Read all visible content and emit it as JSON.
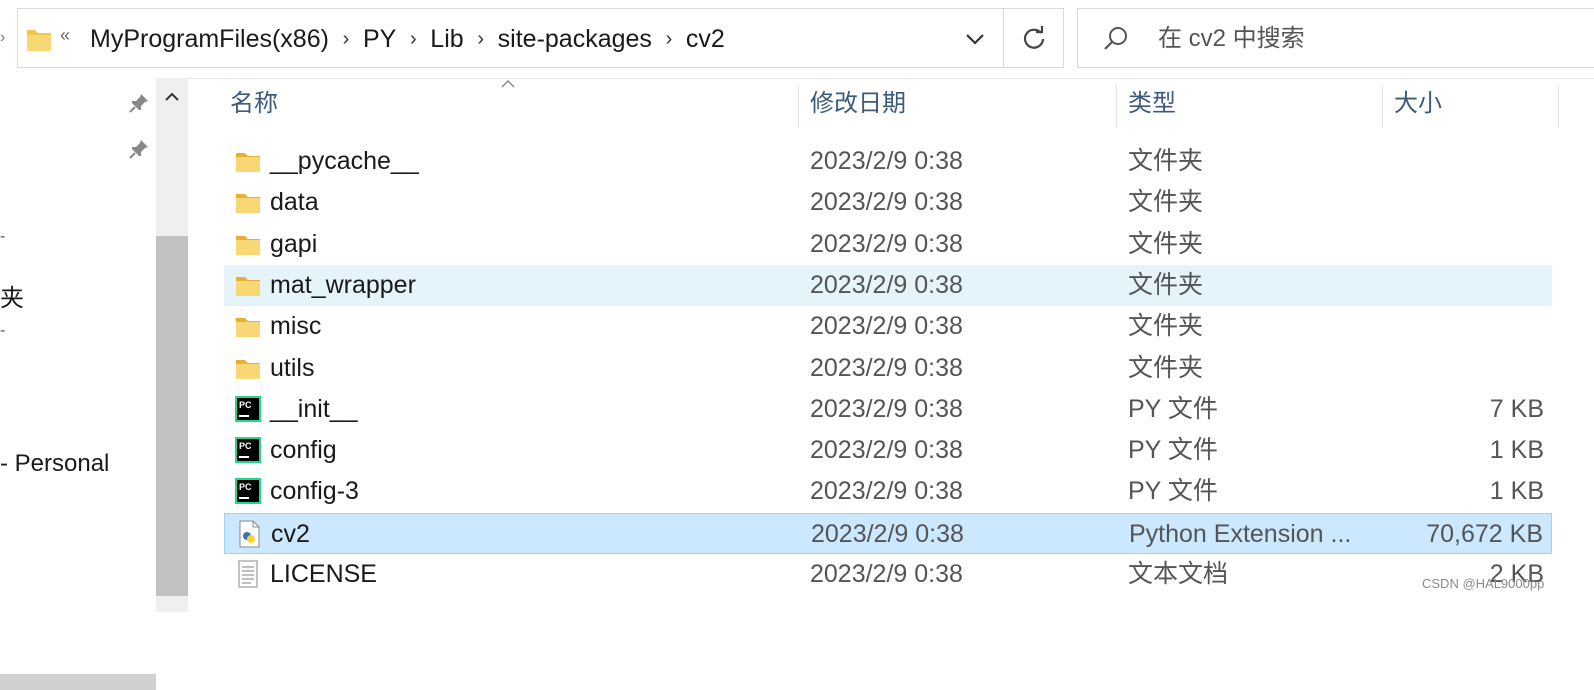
{
  "address_bar": {
    "overflow": "«",
    "crumbs": [
      "MyProgramFiles(x86)",
      "PY",
      "Lib",
      "site-packages",
      "cv2"
    ]
  },
  "search": {
    "placeholder": "在 cv2 中搜索"
  },
  "nav": {
    "frag_1": "夹",
    "frag_2": " - Personal"
  },
  "columns": {
    "name": "名称",
    "date": "修改日期",
    "type": "类型",
    "size": "大小"
  },
  "files": [
    {
      "name": "__pycache__",
      "date": "2023/2/9 0:38",
      "type": "文件夹",
      "size": "",
      "icon": "folder-icon"
    },
    {
      "name": "data",
      "date": "2023/2/9 0:38",
      "type": "文件夹",
      "size": "",
      "icon": "folder-icon"
    },
    {
      "name": "gapi",
      "date": "2023/2/9 0:38",
      "type": "文件夹",
      "size": "",
      "icon": "folder-icon"
    },
    {
      "name": "mat_wrapper",
      "date": "2023/2/9 0:38",
      "type": "文件夹",
      "size": "",
      "icon": "folder-icon",
      "state": "hover"
    },
    {
      "name": "misc",
      "date": "2023/2/9 0:38",
      "type": "文件夹",
      "size": "",
      "icon": "folder-icon"
    },
    {
      "name": "utils",
      "date": "2023/2/9 0:38",
      "type": "文件夹",
      "size": "",
      "icon": "folder-icon"
    },
    {
      "name": "__init__",
      "date": "2023/2/9 0:38",
      "type": "PY 文件",
      "size": "7 KB",
      "icon": "pycharm-file-icon"
    },
    {
      "name": "config",
      "date": "2023/2/9 0:38",
      "type": "PY 文件",
      "size": "1 KB",
      "icon": "pycharm-file-icon"
    },
    {
      "name": "config-3",
      "date": "2023/2/9 0:38",
      "type": "PY 文件",
      "size": "1 KB",
      "icon": "pycharm-file-icon"
    },
    {
      "name": "cv2",
      "date": "2023/2/9 0:38",
      "type": "Python Extension ...",
      "size": "70,672 KB",
      "icon": "python-extension-icon",
      "state": "selected"
    },
    {
      "name": "LICENSE",
      "date": "2023/2/9 0:38",
      "type": "文本文档",
      "size": "2 KB",
      "icon": "text-document-icon"
    }
  ],
  "watermark": "CSDN @HAL9000pp",
  "colors": {
    "accent_selected": "#cce8ff",
    "hover": "#e5f3fb",
    "header_text": "#3c5a7c",
    "folder": "#f4c54a"
  }
}
